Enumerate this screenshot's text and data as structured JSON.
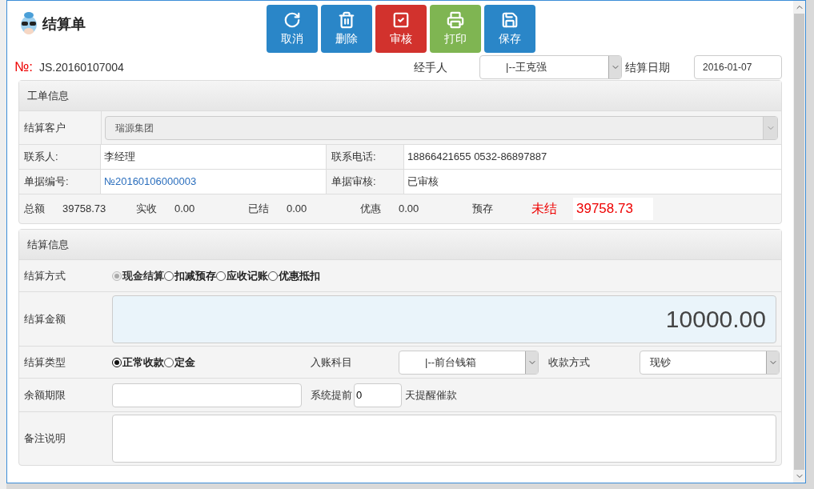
{
  "window": {
    "title": "结算单"
  },
  "toolbar": [
    {
      "label": "取消",
      "kind": "undo",
      "color": "#2a86c8"
    },
    {
      "label": "删除",
      "kind": "trash",
      "color": "#2a86c8"
    },
    {
      "label": "审核",
      "kind": "check",
      "color": "#d2322d"
    },
    {
      "label": "打印",
      "kind": "print",
      "color": "#7fb552"
    },
    {
      "label": "保存",
      "kind": "save",
      "color": "#2a86c8"
    }
  ],
  "header": {
    "number_label": "№:",
    "number": "JS.20160107004",
    "handler_label": "经手人",
    "handler": "|--王克强",
    "date_label": "结算日期",
    "date": "2016-01-07"
  },
  "order_info": {
    "title": "工单信息",
    "customer_label": "结算客户",
    "customer": "瑞源集团",
    "fields": [
      {
        "label": "联系人:",
        "value": "李经理",
        "kind": "text"
      },
      {
        "label": "联系电话:",
        "value": "18866421655 0532-86897887",
        "kind": "text"
      },
      {
        "label": "单据编号:",
        "value": "№20160106000003",
        "kind": "link"
      },
      {
        "label": "单据审核:",
        "value": "已审核",
        "kind": "text"
      }
    ],
    "totals": [
      {
        "label": "总额",
        "value": "39758.73"
      },
      {
        "label": "实收",
        "value": "0.00"
      },
      {
        "label": "已结",
        "value": "0.00"
      },
      {
        "label": "优惠",
        "value": "0.00"
      },
      {
        "label": "预存"
      }
    ],
    "status": "未结",
    "outstanding": "39758.73"
  },
  "settle_info": {
    "title": "结算信息",
    "method_label": "结算方式",
    "methods": [
      {
        "label": "现金结算",
        "selected": true,
        "disabled": true
      },
      {
        "label": "扣减预存",
        "selected": false,
        "disabled": false
      },
      {
        "label": "应收记账",
        "selected": false,
        "disabled": false
      },
      {
        "label": "优惠抵扣",
        "selected": false,
        "disabled": false
      }
    ],
    "amount_label": "结算金额",
    "amount": "10000.00",
    "type_label": "结算类型",
    "types": [
      {
        "label": "正常收款",
        "selected": true
      },
      {
        "label": "定金",
        "selected": false
      }
    ],
    "account_label": "入账科目",
    "account": "|--前台钱箱",
    "payment_label": "收款方式",
    "payment": "现钞",
    "term_label": "余额期限",
    "remind_label": "系统提前",
    "remind_days": "0",
    "remind_suffix": "天提醒催款",
    "note_label": "备注说明"
  }
}
